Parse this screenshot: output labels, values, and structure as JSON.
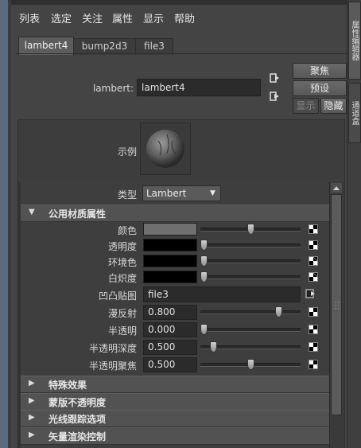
{
  "window": {
    "title": "属性编辑器"
  },
  "menu": [
    "列表",
    "选定",
    "关注",
    "属性",
    "显示",
    "帮助"
  ],
  "tabs": [
    {
      "label": "lambert4",
      "active": true
    },
    {
      "label": "bump2d3",
      "active": false
    },
    {
      "label": "file3",
      "active": false
    }
  ],
  "node": {
    "type_label": "lambert:",
    "name": "lambert4"
  },
  "buttons": {
    "focus": "聚焦",
    "presets": "预设",
    "show": "显示",
    "hide": "隐藏"
  },
  "sample": {
    "label": "示例"
  },
  "type_field": {
    "label": "类型",
    "value": "Lambert"
  },
  "common_section": {
    "title": "公用材质属性",
    "attributes": [
      {
        "label": "颜色",
        "kind": "color",
        "color": "#6f6f6f",
        "level": 0.5
      },
      {
        "label": "透明度",
        "kind": "color",
        "color": "#000000",
        "level": 0.0
      },
      {
        "label": "环境色",
        "kind": "color",
        "color": "#000000",
        "level": 0.0
      },
      {
        "label": "白炽度",
        "kind": "color",
        "color": "#000000",
        "level": 0.0
      },
      {
        "label": "凹凸贴图",
        "kind": "map",
        "value": "file3"
      },
      {
        "label": "漫反射",
        "kind": "number",
        "value": "0.800",
        "level": 0.8
      },
      {
        "label": "半透明",
        "kind": "number",
        "value": "0.000",
        "level": 0.0
      },
      {
        "label": "半透明深度",
        "kind": "number",
        "value": "0.500",
        "level": 0.1
      },
      {
        "label": "半透明聚焦",
        "kind": "number",
        "value": "0.500",
        "level": 0.5
      }
    ]
  },
  "collapsed_sections": [
    "特殊效果",
    "蒙版不透明度",
    "光线跟踪选项",
    "矢量渲染控制"
  ],
  "right_tabs": [
    "属性编辑器",
    "通道盒"
  ]
}
